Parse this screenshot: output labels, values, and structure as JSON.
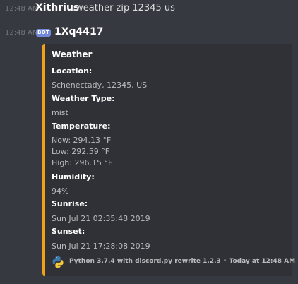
{
  "messages": [
    {
      "timestamp": "12:48 AM",
      "username": "Xithrius",
      "content": ".weather zip 12345 us"
    },
    {
      "timestamp": "12:48 AM",
      "bot_tag": "BOT",
      "username": "1Xq4417"
    }
  ],
  "embed": {
    "accent_color": "#f1a019",
    "title": "Weather",
    "fields": [
      {
        "name": "Location:",
        "values": [
          "Schenectady, 12345, US"
        ]
      },
      {
        "name": "Weather Type:",
        "values": [
          "mist"
        ]
      },
      {
        "name": "Temperature:",
        "values": [
          "Now: 294.13 °F",
          "Low: 292.59 °F",
          "High: 296.15 °F"
        ]
      },
      {
        "name": "Humidity:",
        "values": [
          "94%"
        ]
      },
      {
        "name": "Sunrise:",
        "values": [
          "Sun Jul 21 02:35:48 2019"
        ]
      },
      {
        "name": "Sunset:",
        "values": [
          "Sun Jul 21 17:28:08 2019"
        ]
      }
    ],
    "footer": {
      "icon": "python-logo-icon",
      "text": "Python 3.7.4 with discord.py rewrite 1.2.3",
      "separator": "•",
      "timestamp": "Today at 12:48 AM"
    }
  },
  "colors": {
    "background": "#36393f",
    "embed_background": "#2f3136",
    "bot_tag": "#7289da"
  }
}
